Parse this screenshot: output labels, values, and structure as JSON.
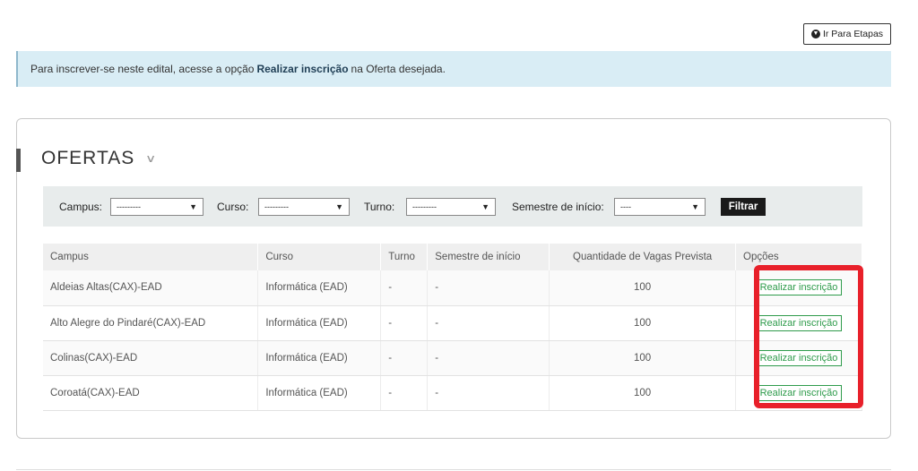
{
  "header": {
    "goto_label": "Ir Para Etapas"
  },
  "info": {
    "text_before": "Para inscrever-se neste edital, acesse a opção",
    "bold": "Realizar inscrição",
    "text_after": "na Oferta desejada."
  },
  "offers": {
    "title": "OFERTAS",
    "filters": {
      "campus_label": "Campus:",
      "campus_value": "---------",
      "curso_label": "Curso:",
      "curso_value": "---------",
      "turno_label": "Turno:",
      "turno_value": "---------",
      "semestre_label": "Semestre de início:",
      "semestre_value": "----",
      "filter_button": "Filtrar"
    },
    "columns": [
      "Campus",
      "Curso",
      "Turno",
      "Semestre de início",
      "Quantidade de Vagas Prevista",
      "Opções"
    ],
    "rows": [
      {
        "campus": "Aldeias Altas(CAX)-EAD",
        "curso": "Informática (EAD)",
        "turno": "-",
        "semestre": "-",
        "vagas": "100",
        "action": "Realizar inscrição"
      },
      {
        "campus": "Alto Alegre do Pindaré(CAX)-EAD",
        "curso": "Informática (EAD)",
        "turno": "-",
        "semestre": "-",
        "vagas": "100",
        "action": "Realizar inscrição"
      },
      {
        "campus": "Colinas(CAX)-EAD",
        "curso": "Informática (EAD)",
        "turno": "-",
        "semestre": "-",
        "vagas": "100",
        "action": "Realizar inscrição"
      },
      {
        "campus": "Coroatá(CAX)-EAD",
        "curso": "Informática (EAD)",
        "turno": "-",
        "semestre": "-",
        "vagas": "100",
        "action": "Realizar inscrição"
      }
    ]
  },
  "colors": {
    "highlight": "#e8202a",
    "action_green": "#2e9b4b",
    "info_bg": "#d9edf5"
  }
}
